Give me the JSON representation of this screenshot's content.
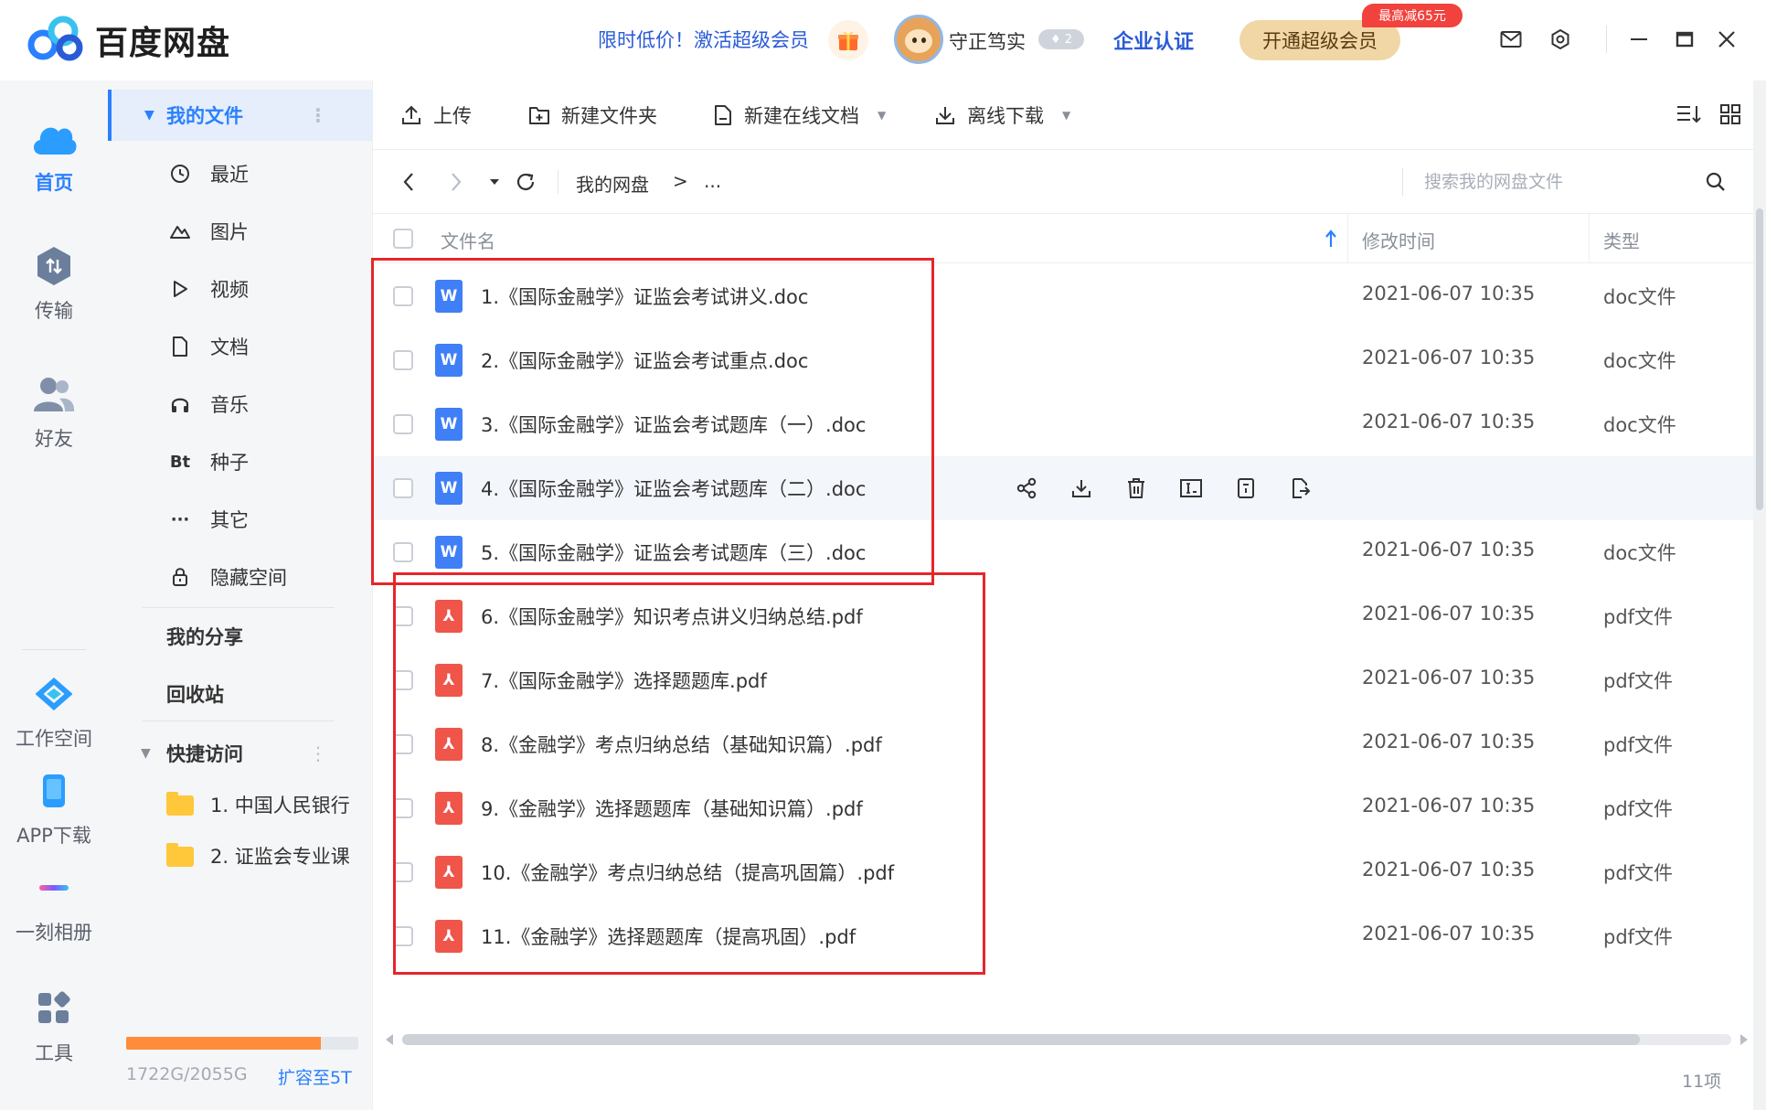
{
  "titlebar": {
    "app_title": "百度网盘",
    "promo": "限时低价！激活超级会员",
    "username": "守正笃实",
    "level": "♦ 2",
    "enterprise": "企业认证",
    "vip_button": "开通超级会员",
    "discount_badge": "最高减65元"
  },
  "rail": {
    "home": "首页",
    "transfer": "传输",
    "friends": "好友",
    "workspace": "工作空间",
    "app_download": "APP下载",
    "album": "一刻相册",
    "tools": "工具"
  },
  "sidebar": {
    "my_files": "我的文件",
    "recent": "最近",
    "images": "图片",
    "video": "视频",
    "docs": "文档",
    "music": "音乐",
    "torrent_icon": "Bt",
    "torrent": "种子",
    "other_icon": "···",
    "other": "其它",
    "hidden": "隐藏空间",
    "my_share": "我的分享",
    "recycle": "回收站",
    "quick_access": "快捷访问",
    "quick_folders": [
      "1. 中国人民银行",
      "2. 证监会专业课"
    ],
    "storage_text": "1722G/2055G",
    "storage_fraction": 0.838,
    "expand": "扩容至5T"
  },
  "toolbar": {
    "upload": "上传",
    "new_folder": "新建文件夹",
    "new_online_doc": "新建在线文档",
    "offline_download": "离线下载"
  },
  "path": {
    "root": "我的网盘",
    "separator": ">",
    "ellipsis": "...",
    "search_placeholder": "搜索我的网盘文件"
  },
  "table": {
    "headers": {
      "name": "文件名",
      "modified": "修改时间",
      "type": "类型"
    },
    "files": [
      {
        "name": "1.《国际金融学》证监会考试讲义.doc",
        "date": "2021-06-07 10:35",
        "type": "doc文件",
        "kind": "doc"
      },
      {
        "name": "2.《国际金融学》证监会考试重点.doc",
        "date": "2021-06-07 10:35",
        "type": "doc文件",
        "kind": "doc"
      },
      {
        "name": "3.《国际金融学》证监会考试题库（一）.doc",
        "date": "2021-06-07 10:35",
        "type": "doc文件",
        "kind": "doc"
      },
      {
        "name": "4.《国际金融学》证监会考试题库（二）.doc",
        "date": "",
        "type": "",
        "kind": "doc"
      },
      {
        "name": "5.《国际金融学》证监会考试题库（三）.doc",
        "date": "2021-06-07 10:35",
        "type": "doc文件",
        "kind": "doc"
      },
      {
        "name": "6.《国际金融学》知识考点讲义归纳总结.pdf",
        "date": "2021-06-07 10:35",
        "type": "pdf文件",
        "kind": "pdf"
      },
      {
        "name": "7.《国际金融学》选择题题库.pdf",
        "date": "2021-06-07 10:35",
        "type": "pdf文件",
        "kind": "pdf"
      },
      {
        "name": "8.《金融学》考点归纳总结（基础知识篇）.pdf",
        "date": "2021-06-07 10:35",
        "type": "pdf文件",
        "kind": "pdf"
      },
      {
        "name": "9.《金融学》选择题题库（基础知识篇）.pdf",
        "date": "2021-06-07 10:35",
        "type": "pdf文件",
        "kind": "pdf"
      },
      {
        "name": "10.《金融学》考点归纳总结（提高巩固篇）.pdf",
        "date": "2021-06-07 10:35",
        "type": "pdf文件",
        "kind": "pdf"
      },
      {
        "name": "11.《金融学》选择题题库（提高巩固）.pdf",
        "date": "2021-06-07 10:35",
        "type": "pdf文件",
        "kind": "pdf"
      }
    ],
    "doc_icon_letter": "W",
    "pdf_icon_letter": "⅄"
  },
  "footer": {
    "count": "11项"
  },
  "colors": {
    "accent": "#2a80ff",
    "highlight_box": "#e5262a",
    "doc_icon": "#3f7ff7",
    "pdf_icon": "#f0554a",
    "storage_fill": "#ff8c3a"
  }
}
